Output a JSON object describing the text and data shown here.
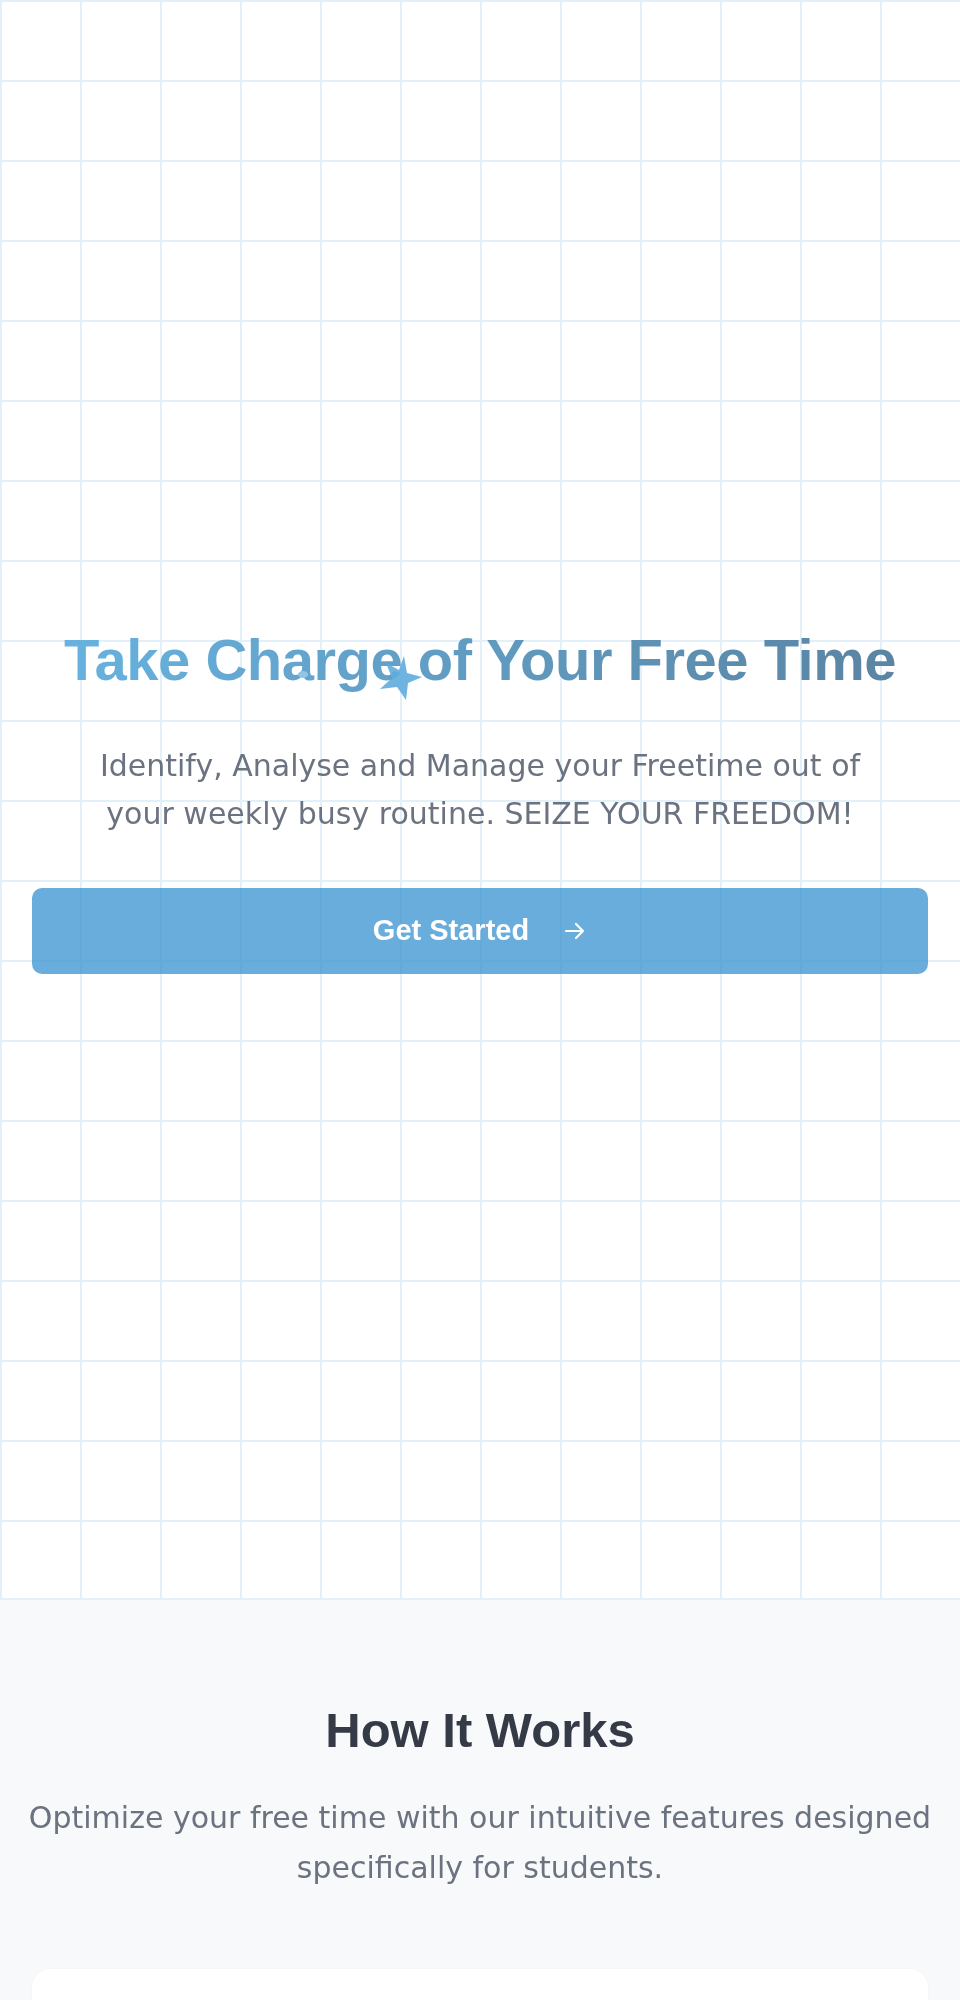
{
  "hero": {
    "title": "Take Charge of Your Free Time",
    "subtitle": "Identify, Analyse and Manage your Freetime out of your weekly busy routine. SEIZE YOUR FREEDOM!",
    "cta": {
      "label": "Get Started"
    }
  },
  "how_it_works": {
    "title": "How It Works",
    "subtitle": "Optimize your free time with our intuitive features designed specifically for students."
  }
}
